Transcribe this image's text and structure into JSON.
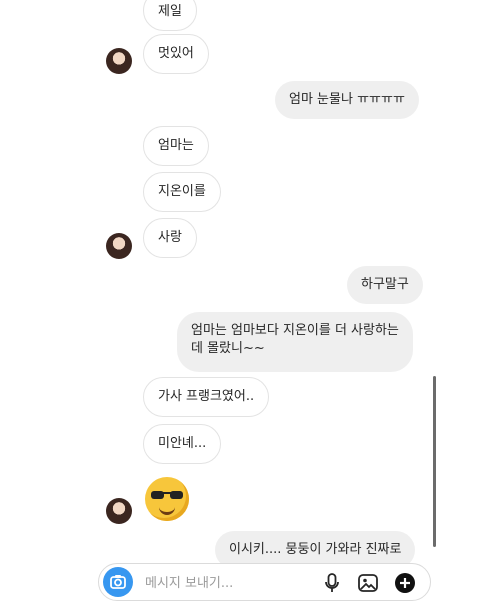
{
  "messages": [
    {
      "side": "in",
      "text": "제일"
    },
    {
      "side": "in",
      "text": "멋있어"
    },
    {
      "side": "out",
      "text": "엄마 눈물나 ㅠㅠㅠㅠ"
    },
    {
      "side": "in",
      "text": "엄마는"
    },
    {
      "side": "in",
      "text": "지온이를"
    },
    {
      "side": "in",
      "text": "사랑"
    },
    {
      "side": "out",
      "text": "하구말구"
    },
    {
      "side": "out",
      "line1": "엄마는 엄마보다 지온이를 더 사랑하는",
      "line2": "데 몰랐니~~"
    },
    {
      "side": "in",
      "text": "가사 프랭크였어.."
    },
    {
      "side": "in",
      "text": "미안녜..."
    },
    {
      "side": "in",
      "emoji": "smiling-face-with-sunglasses"
    },
    {
      "side": "out",
      "text": "이시키.... 뭉둥이 가와라 진짜로"
    }
  ],
  "composer": {
    "placeholder": "메시지 보내기...",
    "icons": [
      "camera-icon",
      "microphone-icon",
      "image-icon",
      "add-circle-icon"
    ]
  },
  "colors": {
    "accent": "#3797f0",
    "outgoing_bubble": "#efefef",
    "incoming_border": "#e3e3e3"
  }
}
